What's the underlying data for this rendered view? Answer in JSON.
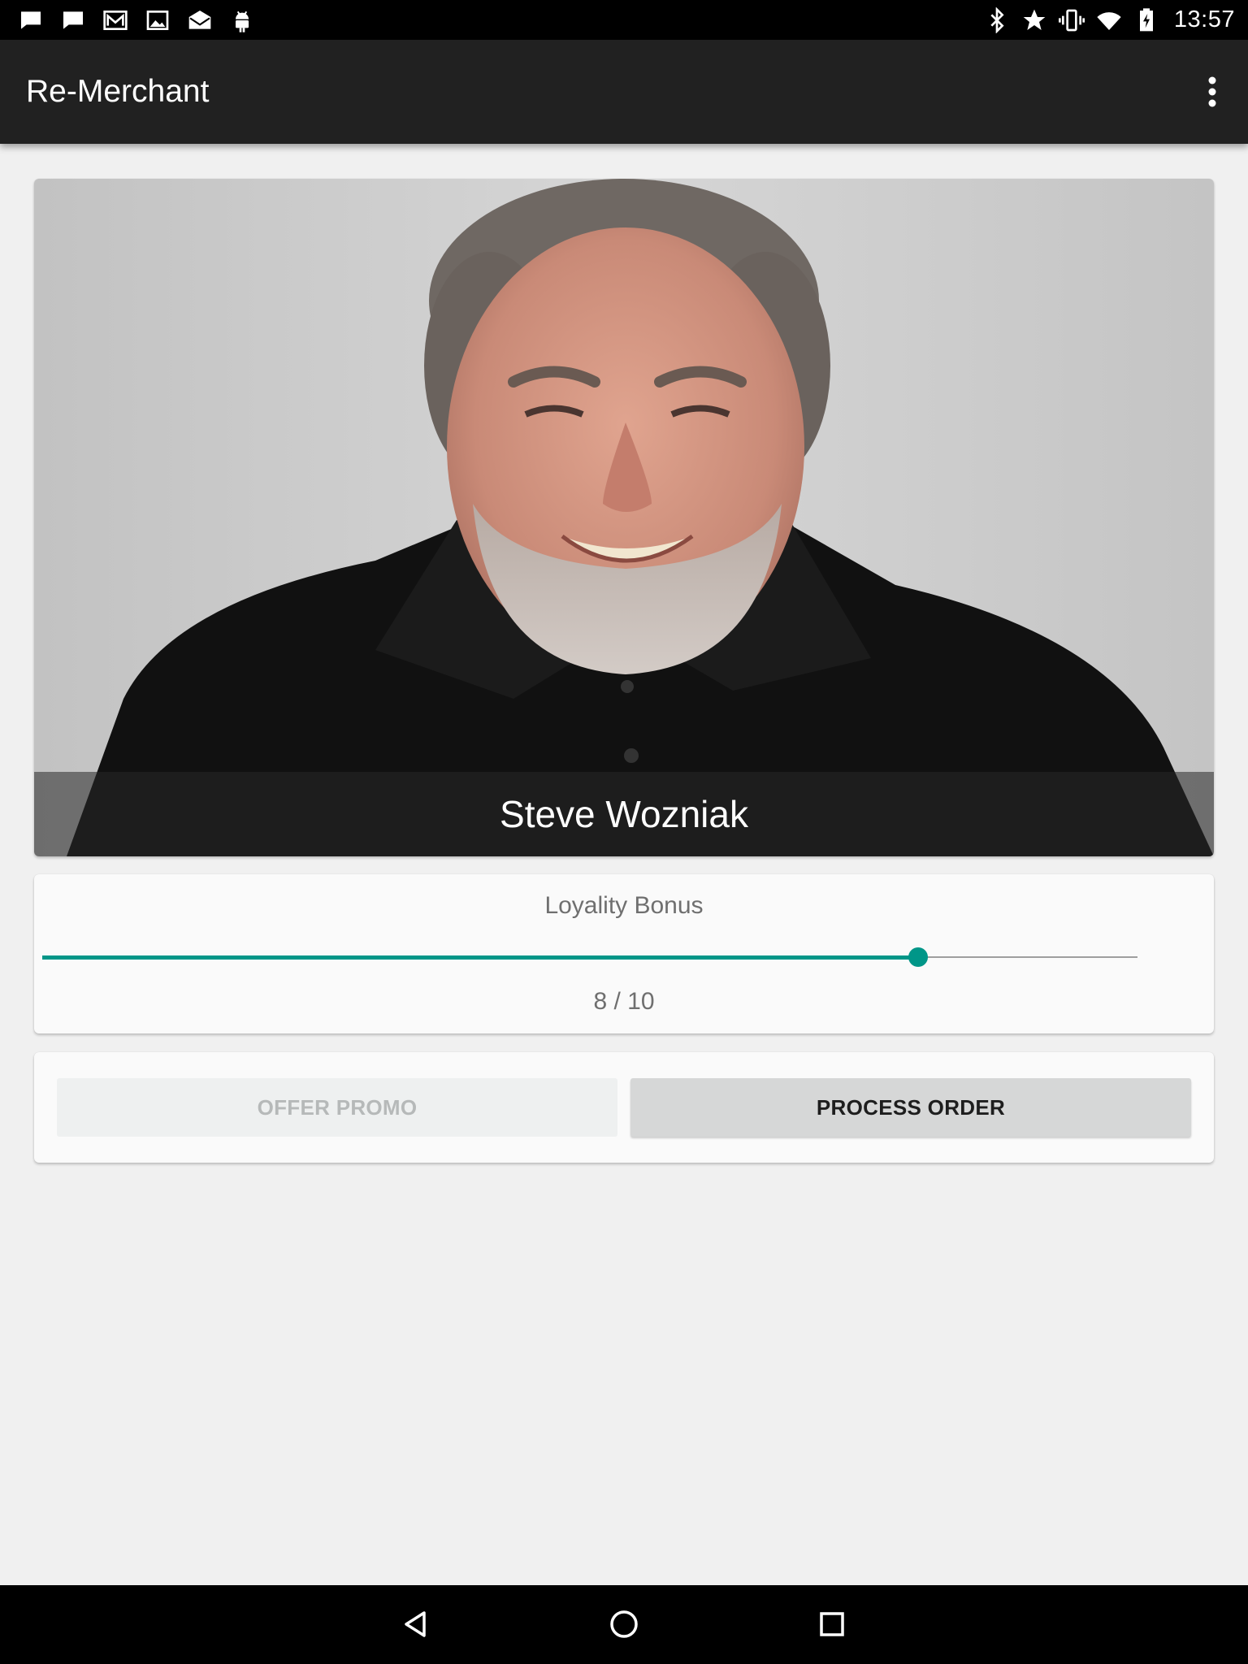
{
  "status_bar": {
    "time": "13:57",
    "left_icons": [
      "message-icon",
      "message-icon",
      "gmail-icon",
      "image-icon",
      "mail-icon",
      "android-icon"
    ],
    "right_icons": [
      "bluetooth-icon",
      "star-icon",
      "vibrate-icon",
      "wifi-icon",
      "battery-charging-icon"
    ]
  },
  "app_bar": {
    "title": "Re-Merchant",
    "overflow_icon": "more-vert-icon"
  },
  "profile": {
    "name": "Steve Wozniak"
  },
  "loyalty": {
    "label": "Loyality Bonus",
    "value": 8,
    "max": 10,
    "display": "8 / 10",
    "accent_color": "#009688"
  },
  "actions": {
    "offer_promo_label": "OFFER PROMO",
    "offer_promo_enabled": false,
    "process_order_label": "PROCESS ORDER"
  },
  "nav_bar": {
    "icons": [
      "back-icon",
      "home-icon",
      "recents-icon"
    ]
  }
}
